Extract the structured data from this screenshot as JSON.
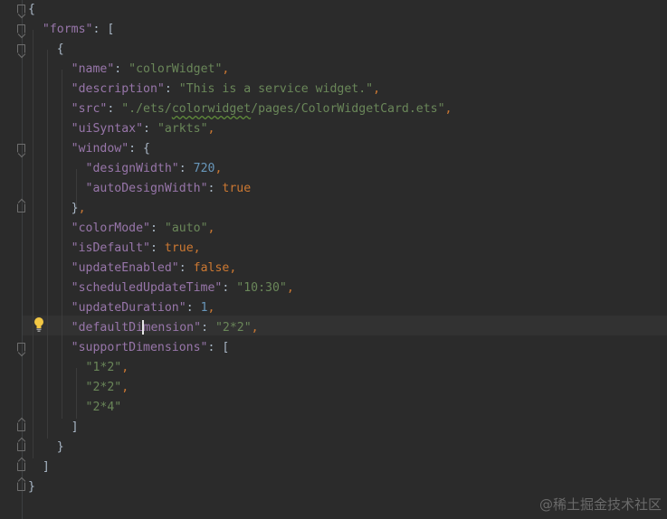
{
  "editor": {
    "watermark": "@稀土掘金技术社区",
    "icons": {
      "intention_bulb": "lightbulb-icon",
      "fold_marker": "fold-marker-icon"
    },
    "colors": {
      "background": "#2b2b2b",
      "key": "#9876aa",
      "string": "#6a8759",
      "number": "#6897bb",
      "keyword": "#cc7832",
      "punctuation": "#a9b7c6"
    },
    "lines": [
      {
        "tokens": [
          [
            "t",
            "{"
          ]
        ]
      },
      {
        "tokens": [
          [
            "t",
            "  "
          ],
          [
            "k",
            "\"forms\""
          ],
          [
            "t",
            ": ["
          ]
        ]
      },
      {
        "tokens": [
          [
            "t",
            "    {"
          ]
        ]
      },
      {
        "tokens": [
          [
            "t",
            "      "
          ],
          [
            "k",
            "\"name\""
          ],
          [
            "t",
            ": "
          ],
          [
            "s",
            "\"colorWidget\""
          ],
          [
            "p",
            ","
          ]
        ]
      },
      {
        "tokens": [
          [
            "t",
            "      "
          ],
          [
            "k",
            "\"description\""
          ],
          [
            "t",
            ": "
          ],
          [
            "s",
            "\"This is a service widget.\""
          ],
          [
            "p",
            ","
          ]
        ]
      },
      {
        "tokens": [
          [
            "t",
            "      "
          ],
          [
            "k",
            "\"src\""
          ],
          [
            "t",
            ": "
          ],
          [
            "s",
            "\"./ets/"
          ],
          [
            "sq",
            "colorwidget"
          ],
          [
            "s",
            "/pages/ColorWidgetCard.ets\""
          ],
          [
            "p",
            ","
          ]
        ]
      },
      {
        "tokens": [
          [
            "t",
            "      "
          ],
          [
            "k",
            "\"uiSyntax\""
          ],
          [
            "t",
            ": "
          ],
          [
            "s",
            "\"arkts\""
          ],
          [
            "p",
            ","
          ]
        ]
      },
      {
        "tokens": [
          [
            "t",
            "      "
          ],
          [
            "k",
            "\"window\""
          ],
          [
            "t",
            ": {"
          ]
        ]
      },
      {
        "tokens": [
          [
            "t",
            "        "
          ],
          [
            "k",
            "\"designWidth\""
          ],
          [
            "t",
            ": "
          ],
          [
            "n",
            "720"
          ],
          [
            "p",
            ","
          ]
        ]
      },
      {
        "tokens": [
          [
            "t",
            "        "
          ],
          [
            "k",
            "\"autoDesignWidth\""
          ],
          [
            "t",
            ": "
          ],
          [
            "b",
            "true"
          ]
        ]
      },
      {
        "tokens": [
          [
            "t",
            "      }"
          ],
          [
            "p",
            ","
          ]
        ]
      },
      {
        "tokens": [
          [
            "t",
            "      "
          ],
          [
            "k",
            "\"colorMode\""
          ],
          [
            "t",
            ": "
          ],
          [
            "s",
            "\"auto\""
          ],
          [
            "p",
            ","
          ]
        ]
      },
      {
        "tokens": [
          [
            "t",
            "      "
          ],
          [
            "k",
            "\"isDefault\""
          ],
          [
            "t",
            ": "
          ],
          [
            "b",
            "true"
          ],
          [
            "p",
            ","
          ]
        ]
      },
      {
        "tokens": [
          [
            "t",
            "      "
          ],
          [
            "k",
            "\"updateEnabled\""
          ],
          [
            "t",
            ": "
          ],
          [
            "b",
            "false"
          ],
          [
            "p",
            ","
          ]
        ]
      },
      {
        "tokens": [
          [
            "t",
            "      "
          ],
          [
            "k",
            "\"scheduledUpdateTime\""
          ],
          [
            "t",
            ": "
          ],
          [
            "s",
            "\"10:30\""
          ],
          [
            "p",
            ","
          ]
        ]
      },
      {
        "tokens": [
          [
            "t",
            "      "
          ],
          [
            "k",
            "\"updateDuration\""
          ],
          [
            "t",
            ": "
          ],
          [
            "n",
            "1"
          ],
          [
            "p",
            ","
          ]
        ]
      },
      {
        "tokens": [
          [
            "t",
            "      "
          ],
          [
            "k",
            "\"defaultDimension\""
          ],
          [
            "t",
            ": "
          ],
          [
            "s",
            "\"2*2\""
          ],
          [
            "p",
            ","
          ]
        ]
      },
      {
        "tokens": [
          [
            "t",
            "      "
          ],
          [
            "k",
            "\"supportDimensions\""
          ],
          [
            "t",
            ": ["
          ]
        ]
      },
      {
        "tokens": [
          [
            "t",
            "        "
          ],
          [
            "s",
            "\"1*2\""
          ],
          [
            "p",
            ","
          ]
        ]
      },
      {
        "tokens": [
          [
            "t",
            "        "
          ],
          [
            "s",
            "\"2*2\""
          ],
          [
            "p",
            ","
          ]
        ]
      },
      {
        "tokens": [
          [
            "t",
            "        "
          ],
          [
            "s",
            "\"2*4\""
          ]
        ]
      },
      {
        "tokens": [
          [
            "t",
            "      ]"
          ]
        ]
      },
      {
        "tokens": [
          [
            "t",
            "    }"
          ]
        ]
      },
      {
        "tokens": [
          [
            "t",
            "  ]"
          ]
        ]
      },
      {
        "tokens": [
          [
            "t",
            "}"
          ]
        ]
      }
    ]
  }
}
